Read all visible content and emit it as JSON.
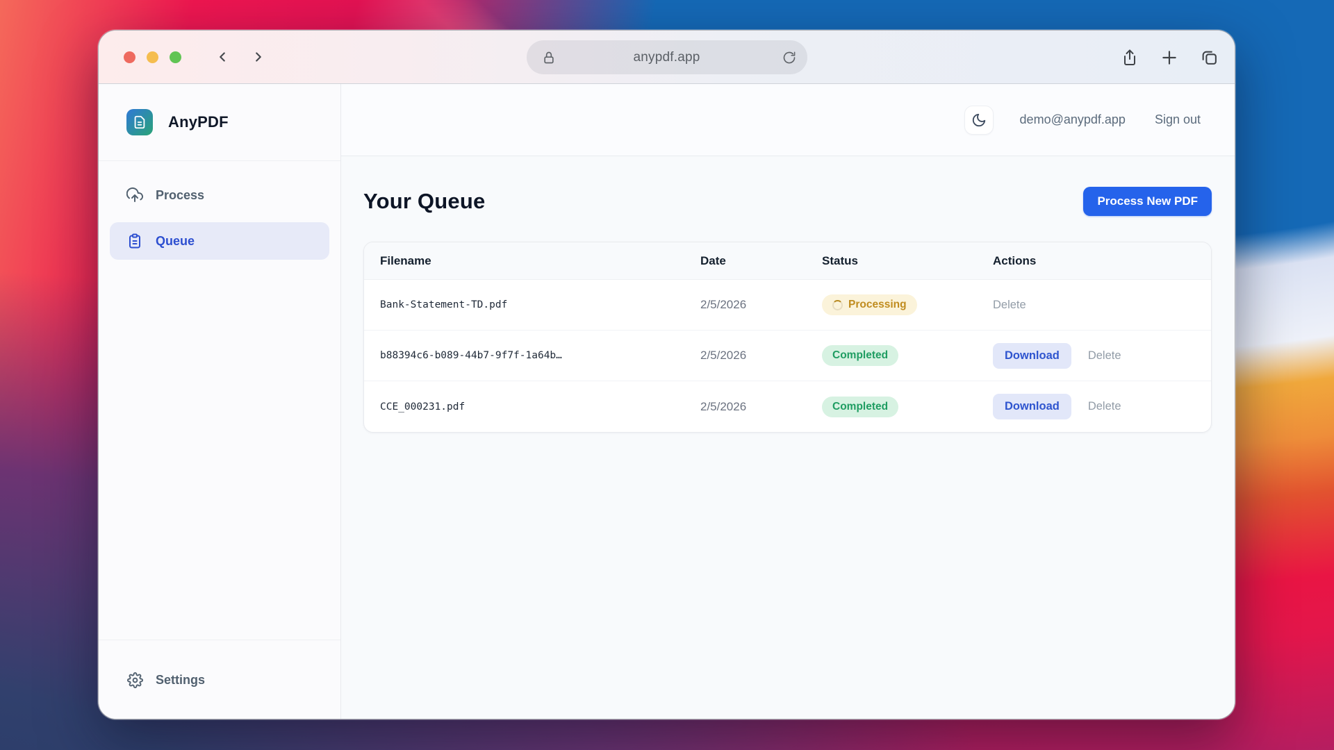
{
  "browser": {
    "url": "anypdf.app"
  },
  "brand": {
    "name": "AnyPDF"
  },
  "sidebar": {
    "items": [
      {
        "label": "Process"
      },
      {
        "label": "Queue"
      }
    ],
    "settings_label": "Settings"
  },
  "topbar": {
    "email": "demo@anypdf.app",
    "sign_out": "Sign out"
  },
  "page": {
    "title": "Your Queue",
    "new_pdf_button": "Process New PDF"
  },
  "table": {
    "columns": [
      "Filename",
      "Date",
      "Status",
      "Actions"
    ],
    "rows": [
      {
        "filename": "Bank-Statement-TD.pdf",
        "date": "2/5/2026",
        "status_label": "Processing",
        "status_key": "processing",
        "delete_label": "Delete"
      },
      {
        "filename": "b88394c6-b089-44b7-9f7f-1a64b…",
        "date": "2/5/2026",
        "status_label": "Completed",
        "status_key": "completed",
        "download_label": "Download",
        "delete_label": "Delete"
      },
      {
        "filename": "CCE_000231.pdf",
        "date": "2/5/2026",
        "status_label": "Completed",
        "status_key": "completed",
        "download_label": "Download",
        "delete_label": "Delete"
      }
    ]
  },
  "colors": {
    "accent": "#2563eb",
    "processing_bg": "#fbf3da",
    "processing_text": "#c08c1f",
    "completed_bg": "#d7f2e2",
    "completed_text": "#1f9d62"
  }
}
